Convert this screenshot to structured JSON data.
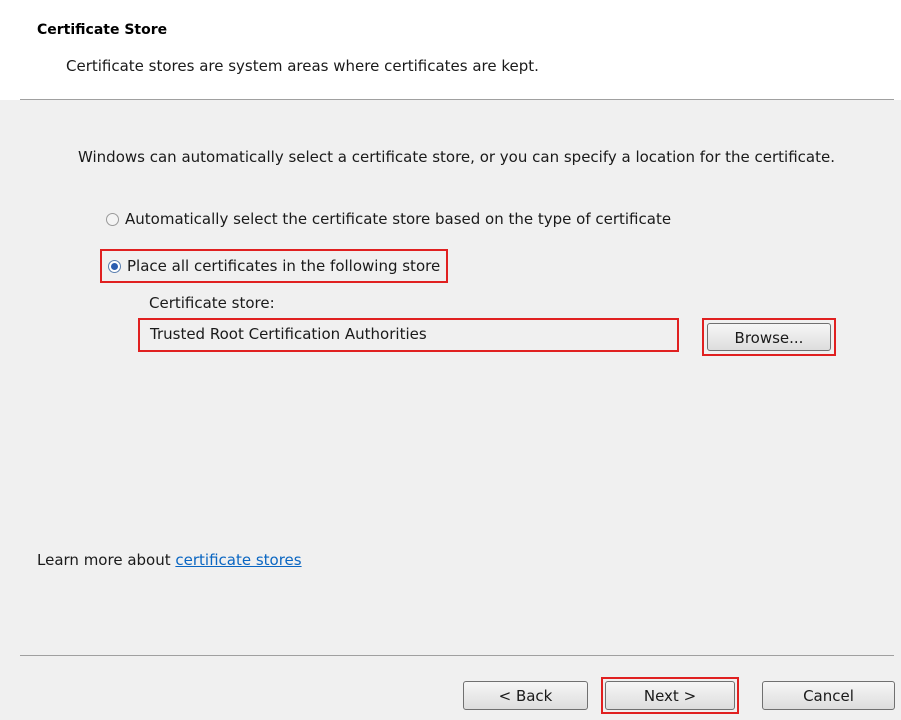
{
  "header": {
    "title": "Certificate Store",
    "description": "Certificate stores are system areas where certificates are kept."
  },
  "intro_text": "Windows can automatically select a certificate store, or you can specify a location for the certificate.",
  "options": {
    "auto_label": "Automatically select the certificate store based on the type of certificate",
    "place_label": "Place all certificates in the following store",
    "selected": "place"
  },
  "store": {
    "label": "Certificate store:",
    "value": "Trusted Root Certification Authorities",
    "browse_label": "Browse..."
  },
  "learn_more": {
    "prefix": "Learn more about ",
    "link_text": "certificate stores"
  },
  "footer": {
    "back_label": "< Back",
    "next_label": "Next >",
    "cancel_label": "Cancel"
  },
  "colors": {
    "highlight_box": "#e02020",
    "link": "#0a66c2",
    "background": "#f0f0f0"
  }
}
